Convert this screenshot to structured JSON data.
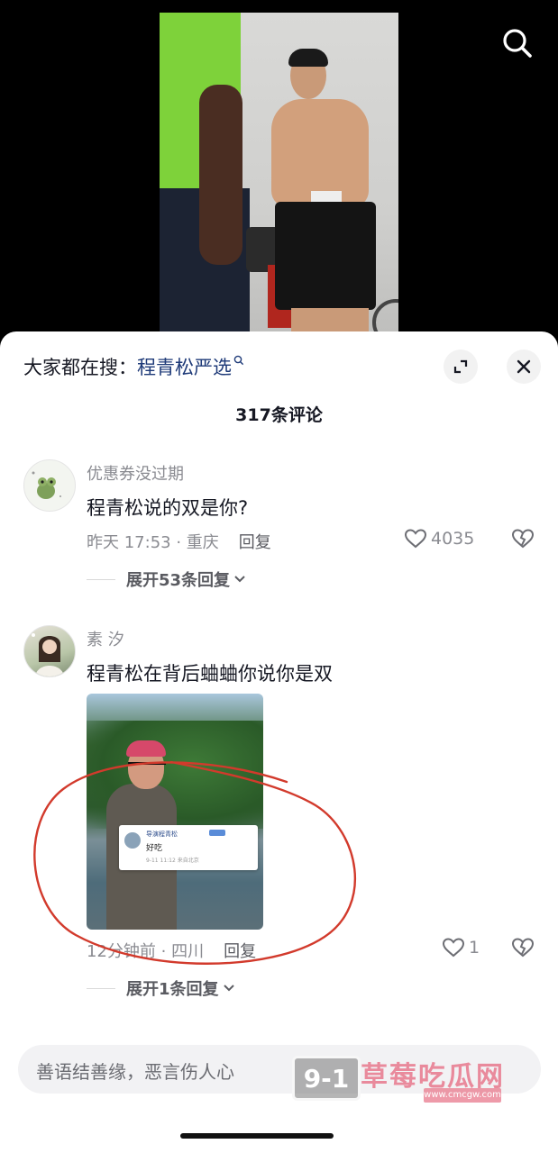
{
  "search_banner": {
    "prefix": "大家都在搜：",
    "query": "程青松严选"
  },
  "comment_count": "317条评论",
  "comments": [
    {
      "author": "优惠券没过期",
      "text": "程青松说的双是你?",
      "time_location": "昨天 17:53 · 重庆",
      "reply_label": "回复",
      "likes": "4035",
      "expand_label": "展开53条回复"
    },
    {
      "author": "素 汐",
      "text": "程青松在背后蛐蛐你说你是双",
      "time_location": "12分钟前 · 四川",
      "reply_label": "回复",
      "likes": "1",
      "expand_label": "展开1条回复",
      "image_card": {
        "name": "导演程青松",
        "body": "好吃",
        "time": "9-11 11:12 来自北京"
      }
    }
  ],
  "input": {
    "placeholder": "善语结善缘，恶言伤人心"
  },
  "watermark": {
    "logo": "9-1",
    "title": "草莓吃瓜网",
    "sub": "www.cmcgw.com"
  },
  "colors": {
    "link": "#1e3a78",
    "secondary_text": "#8a8b91",
    "annotation_red": "#d23a2c"
  }
}
